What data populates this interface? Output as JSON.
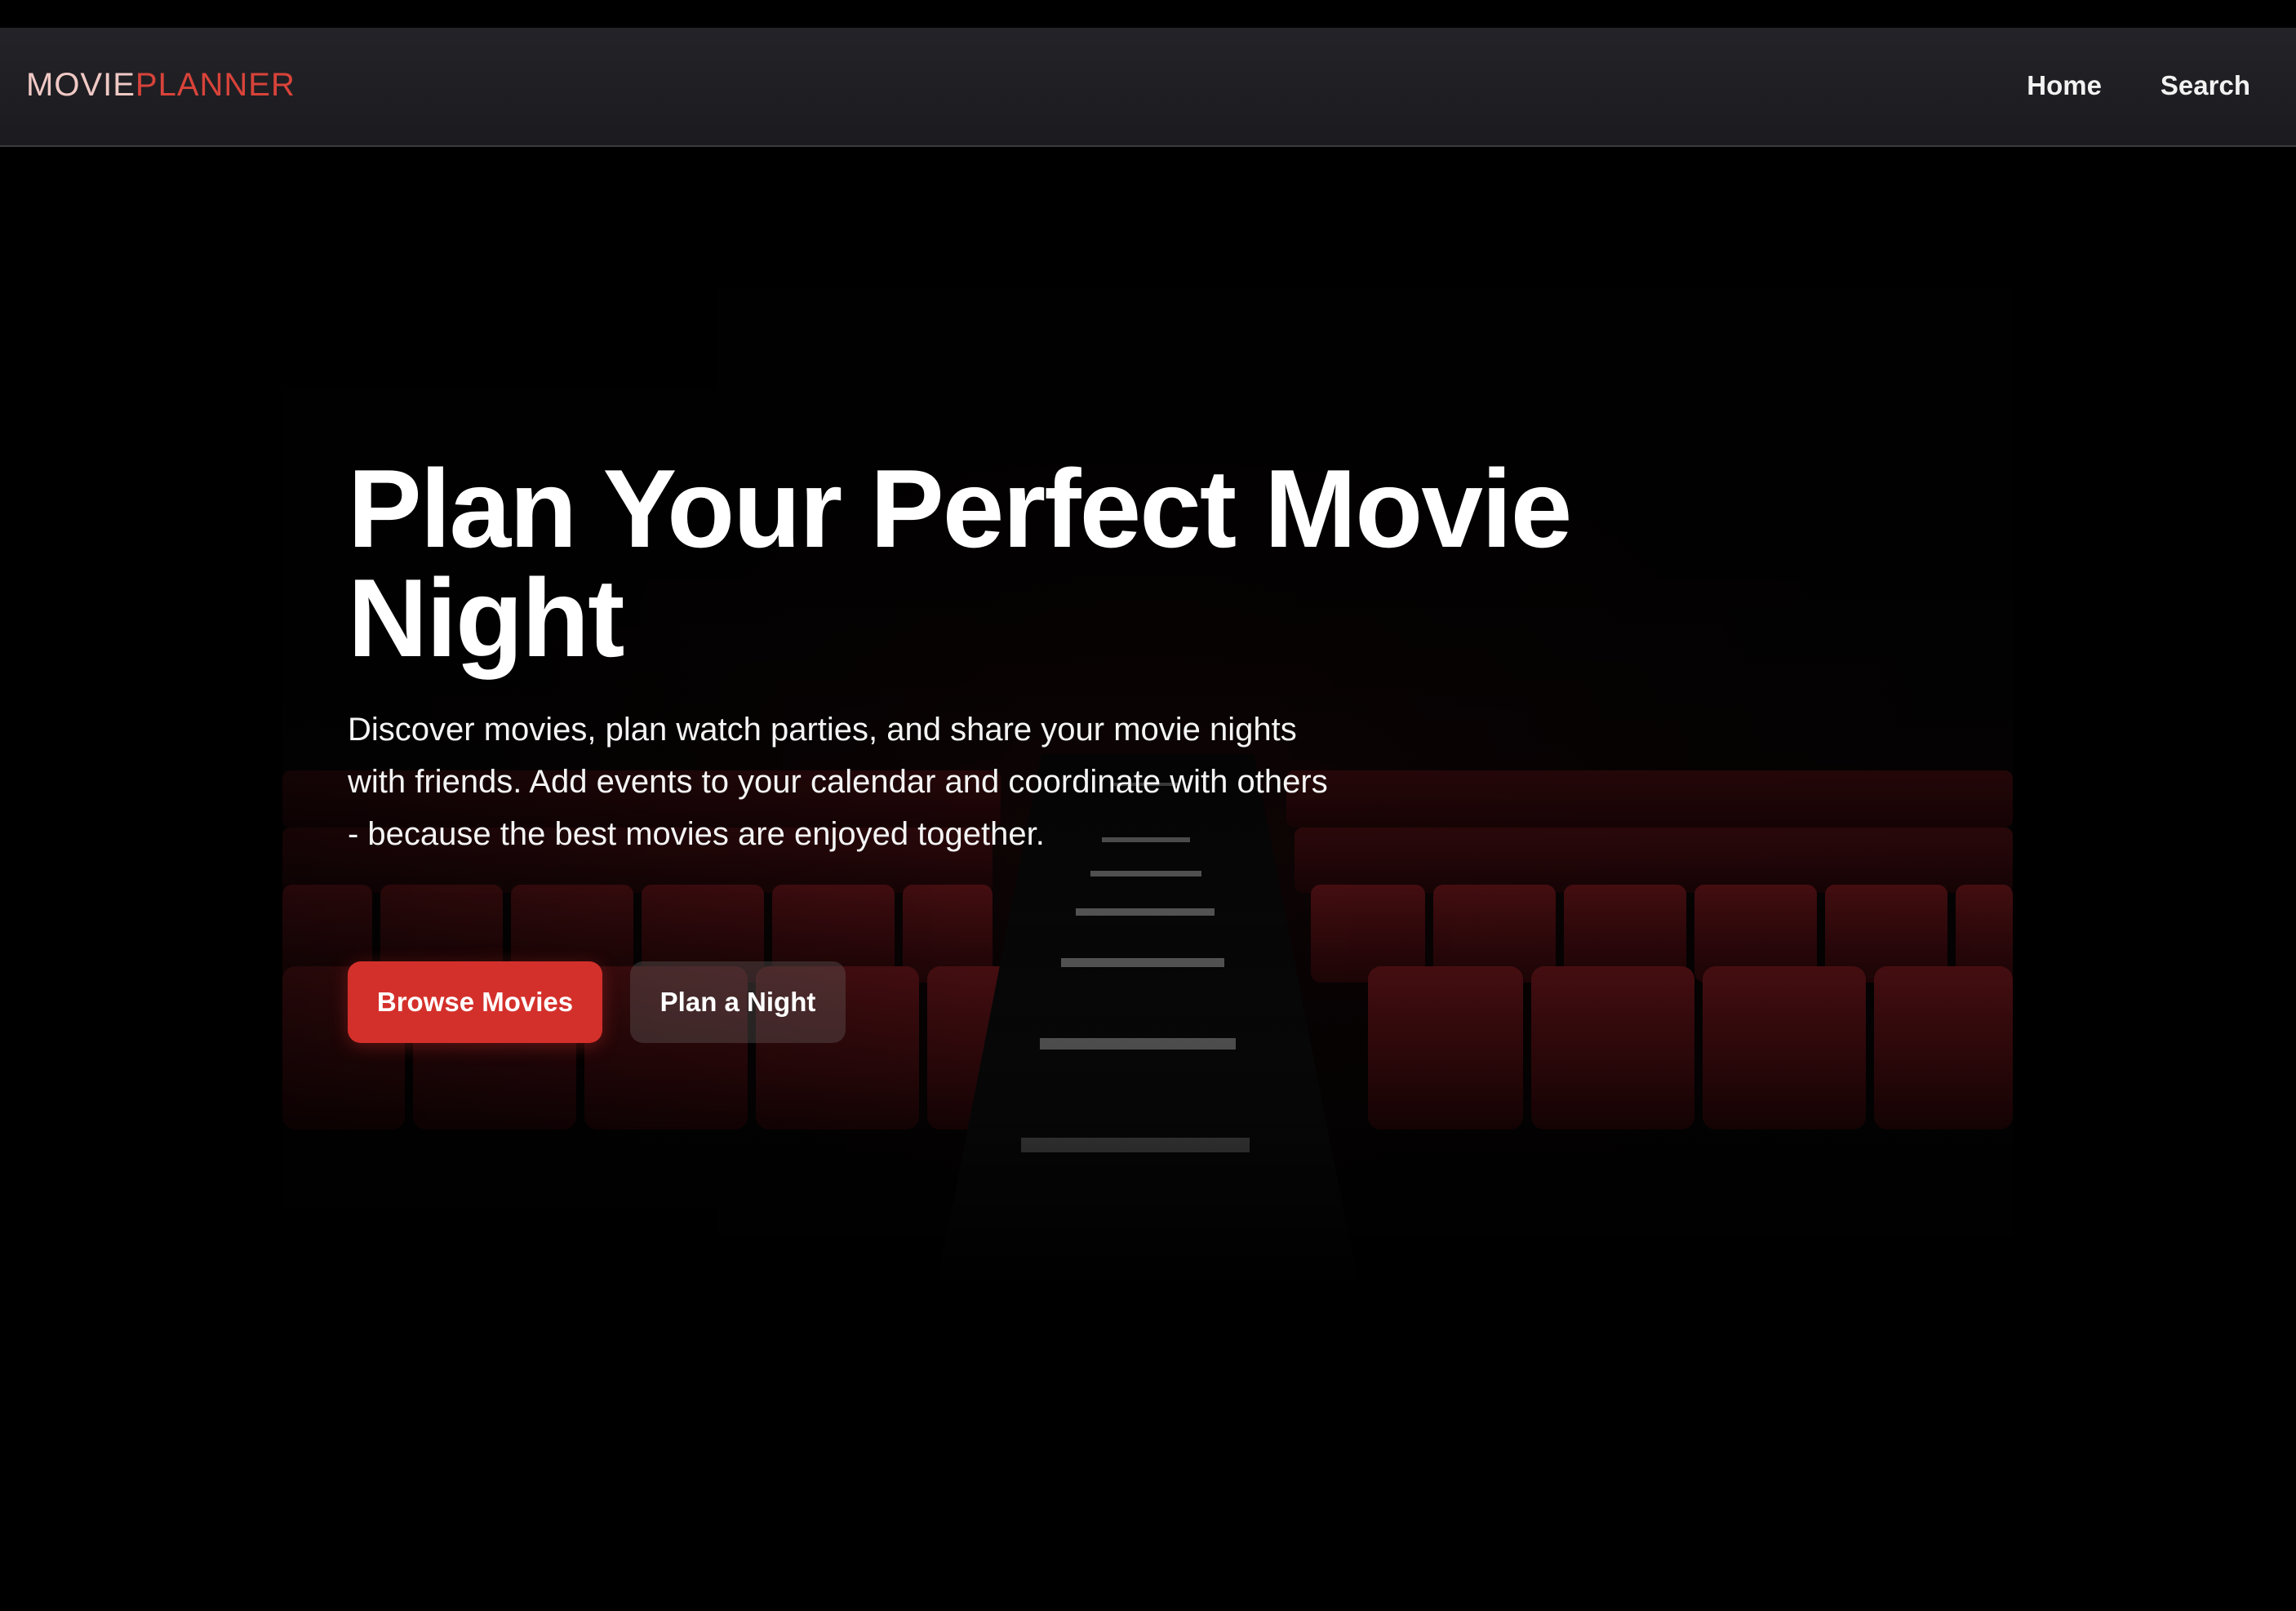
{
  "app": {
    "logo_part1": "MOVIE",
    "logo_part2": "PLANNER"
  },
  "nav": {
    "items": [
      {
        "label": "Home"
      },
      {
        "label": "Search"
      }
    ]
  },
  "hero": {
    "title": "Plan Your Perfect Movie Night",
    "description": "Discover movies, plan watch parties, and share your movie nights with friends. Add events to your calendar and coordinate with others - because the best movies are enjoyed together.",
    "primary_button": "Browse Movies",
    "secondary_button": "Plan a Night",
    "background_icon": "cinema-seats-image"
  },
  "colors": {
    "background": "#000000",
    "navbar": "#1f1f23",
    "accent": "#d4302b",
    "logo_light": "#f0c9c5",
    "logo_red": "#d8433a",
    "seat_red": "#4a0d10"
  }
}
